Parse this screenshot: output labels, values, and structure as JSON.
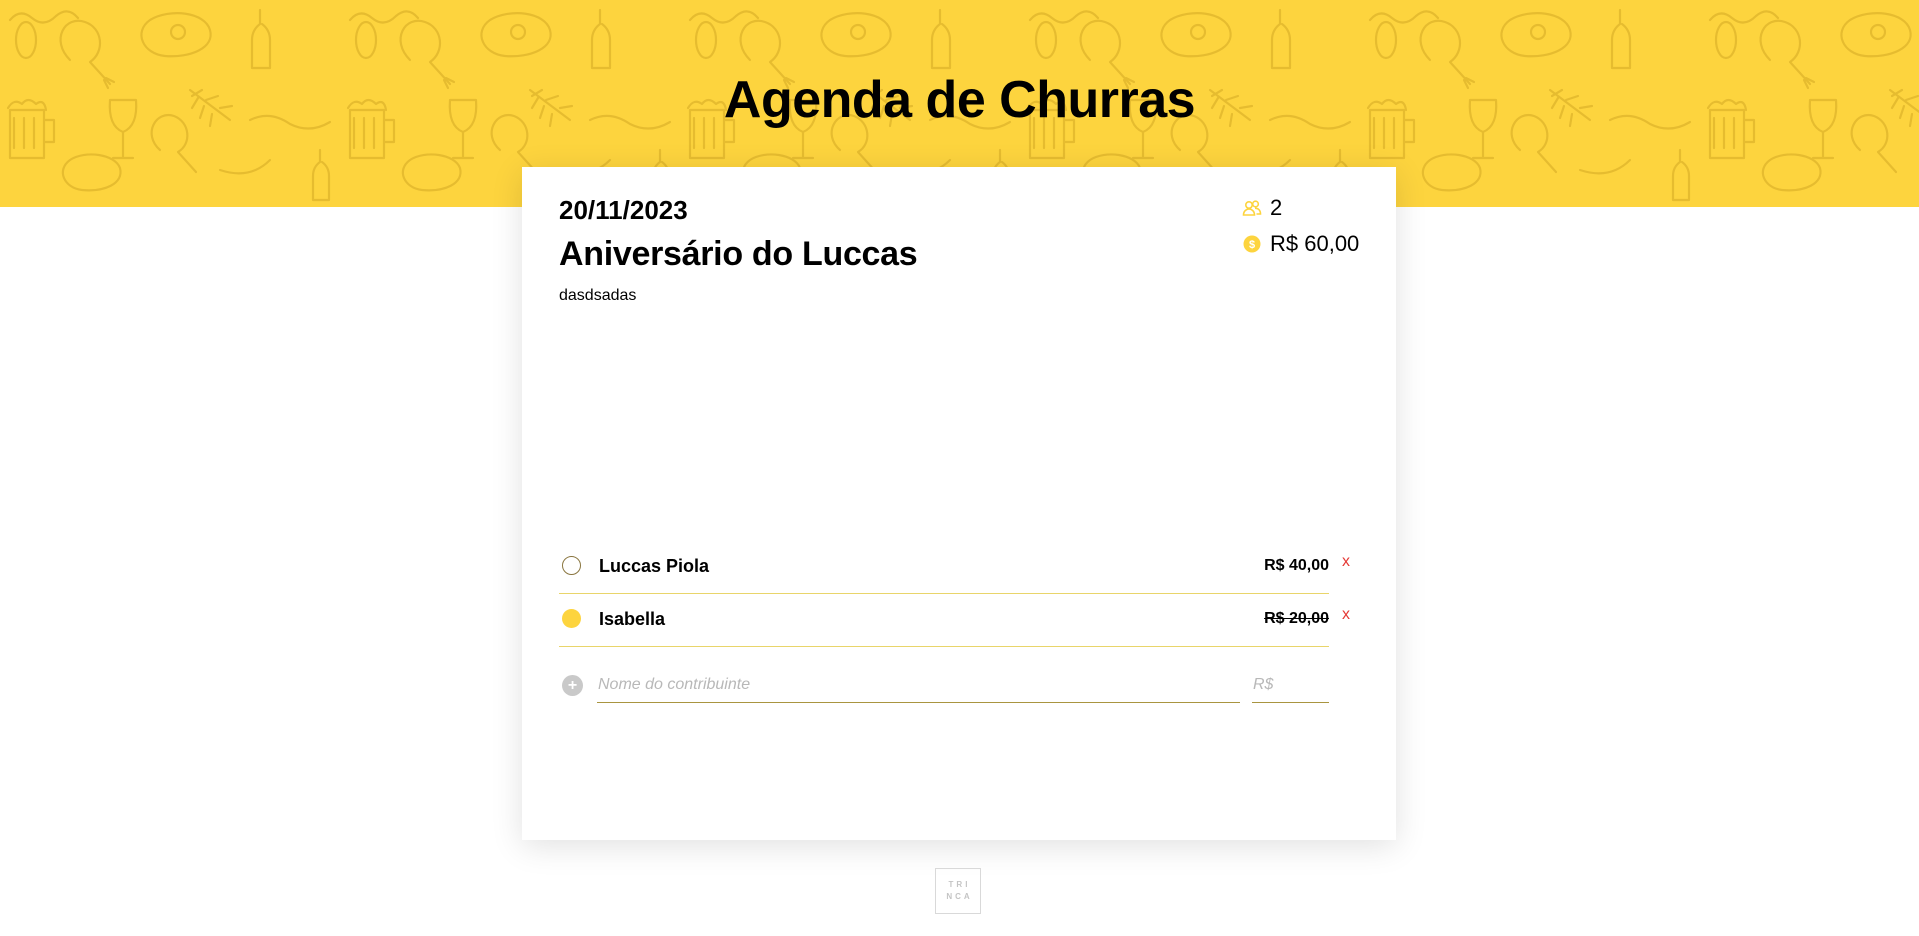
{
  "header": {
    "title": "Agenda de Churras",
    "background_color": "#fdd43e",
    "pattern_icons": [
      "steak-icon",
      "sausage-icon",
      "drumstick-icon",
      "beer-mug-icon",
      "wine-glass-icon",
      "bottle-icon",
      "herb-icon"
    ]
  },
  "event": {
    "date": "20/11/2023",
    "title": "Aniversário do Luccas",
    "description": "dasdsadas",
    "participants_count": "2",
    "total": "R$ 60,00",
    "icons": {
      "participants": "people-icon",
      "total": "dollar-coin-icon"
    }
  },
  "participants": [
    {
      "name": "Luccas Piola",
      "amount": "R$ 40,00",
      "paid": false,
      "remove_label": "x"
    },
    {
      "name": "Isabella",
      "amount": "R$ 20,00",
      "paid": true,
      "remove_label": "x"
    }
  ],
  "new_participant": {
    "name_placeholder": "Nome do contribuinte",
    "value_placeholder": "R$",
    "add_icon": "plus-circle-icon"
  },
  "footer": {
    "logo_line1": "TRI",
    "logo_line2": "NCA"
  },
  "colors": {
    "accent": "#fdd43e",
    "remove": "#e53935",
    "divider": "#e9d56a"
  }
}
